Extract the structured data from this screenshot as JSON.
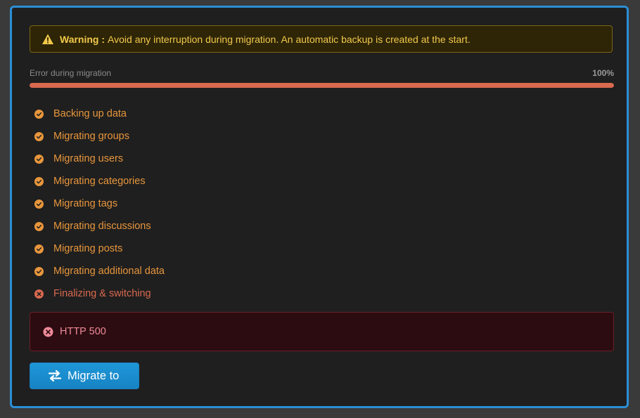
{
  "warning": {
    "label": "Warning :",
    "text": "Avoid any interruption during migration. An automatic backup is created at the start.",
    "icon": "warning-triangle-icon"
  },
  "progress": {
    "status": "Error during migration",
    "percent_label": "100%",
    "value": 1.0
  },
  "steps": [
    {
      "label": "Backing up data",
      "state": "done"
    },
    {
      "label": "Migrating groups",
      "state": "done"
    },
    {
      "label": "Migrating users",
      "state": "done"
    },
    {
      "label": "Migrating categories",
      "state": "done"
    },
    {
      "label": "Migrating tags",
      "state": "done"
    },
    {
      "label": "Migrating discussions",
      "state": "done"
    },
    {
      "label": "Migrating posts",
      "state": "done"
    },
    {
      "label": "Migrating additional data",
      "state": "done"
    },
    {
      "label": "Finalizing & switching",
      "state": "error"
    }
  ],
  "error": {
    "message": "HTTP 500",
    "icon": "error-circle-icon"
  },
  "button": {
    "label": "Migrate to",
    "icon": "swap-arrows-icon"
  },
  "colors": {
    "accent": "#2b8fd6",
    "done": "#e8963c",
    "error": "#d9694f",
    "warning": "#f2c94c"
  }
}
